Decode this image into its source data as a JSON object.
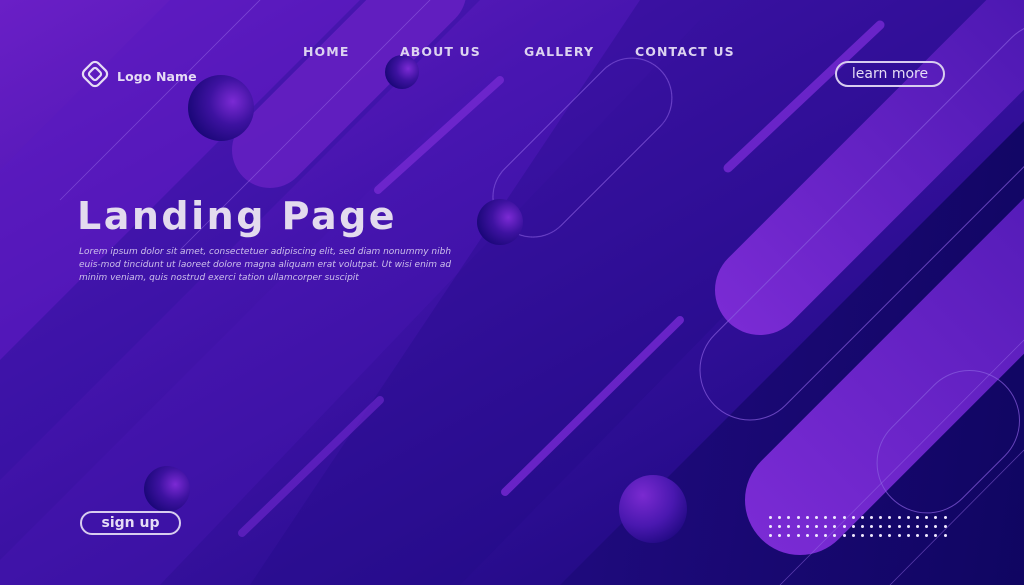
{
  "brand": {
    "logo_icon": "concentric-diamond-icon",
    "name": "Logo Name"
  },
  "nav": {
    "items": [
      {
        "label": "HOME"
      },
      {
        "label": "ABOUT US"
      },
      {
        "label": "GALLERY"
      },
      {
        "label": "CONTACT US"
      }
    ]
  },
  "header": {
    "cta_label": "learn more"
  },
  "hero": {
    "title": "Landing Page",
    "body": "Lorem ipsum dolor sit amet, consectetuer adipiscing elit, sed diam nonummy nibh euis-mod tincidunt ut laoreet dolore magna aliquam erat volutpat. Ut wisi enim ad minim veniam, quis nostrud exerci tation ullamcorper suscipit",
    "signup_label": "sign up"
  },
  "decor": {
    "dot_grid": {
      "rows": 3,
      "cols": 20
    },
    "colors": {
      "background_dark": "#1a0a6e",
      "background_mid": "#3a13a0",
      "background_light": "#6a1fc4",
      "accent_purple": "#7a2ad2",
      "text_light": "#e3dbee"
    }
  }
}
